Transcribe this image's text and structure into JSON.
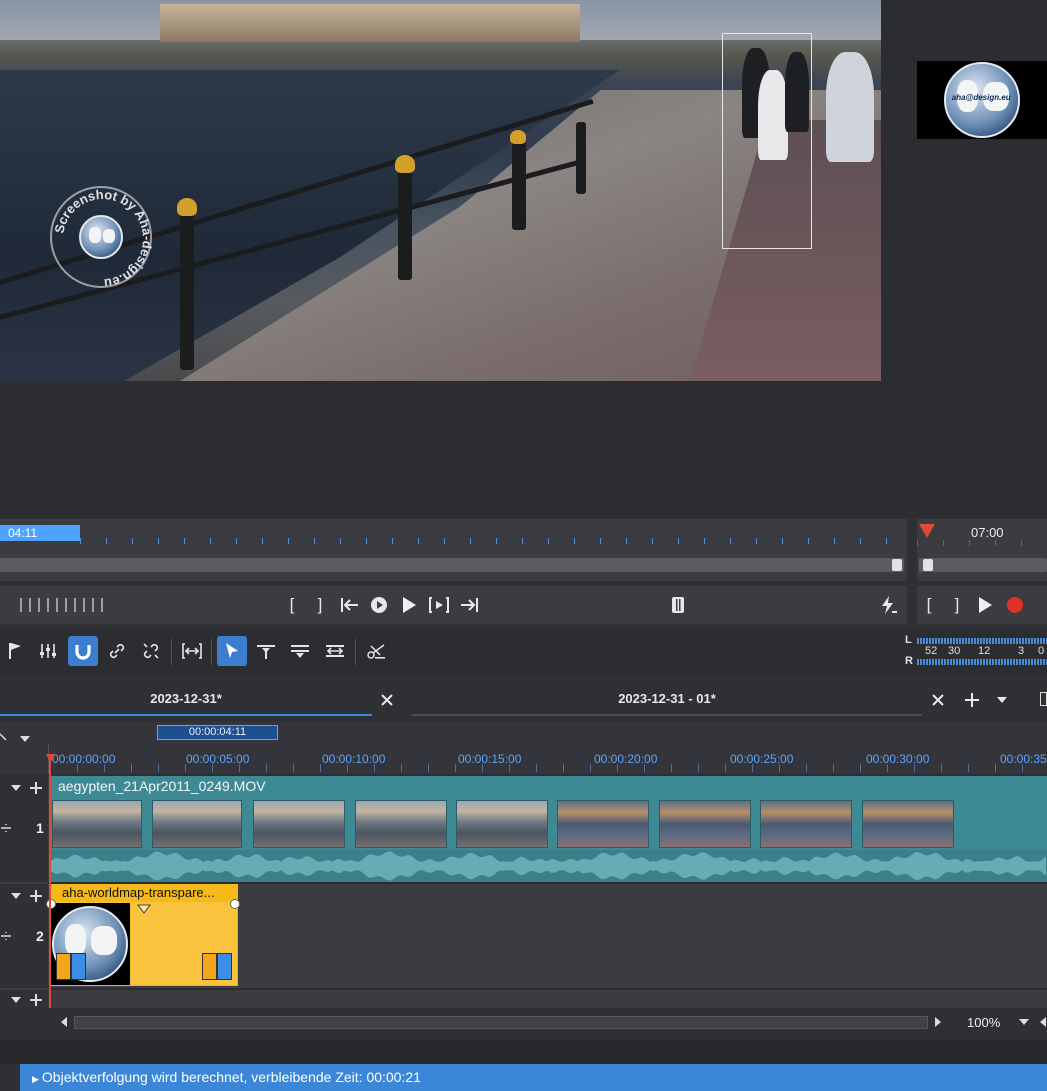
{
  "preview": {
    "watermark_text": "Screenshot by Aha-design.eu",
    "globe_text": "aha@design.eu"
  },
  "scrub": {
    "left_time": "04:11",
    "right_time": "07:00"
  },
  "transport": {
    "mark_in": "[",
    "mark_out": "]",
    "prev_edit": "[←",
    "play": "▶",
    "next_edit": "[▸]",
    "goto_end": "→|",
    "record": "●"
  },
  "audio_meter": {
    "left_label": "L",
    "right_label": "R",
    "scale": [
      "52",
      "30",
      "12",
      "3",
      "0"
    ]
  },
  "tabs": [
    {
      "label": "2023-12-31*",
      "active": true
    },
    {
      "label": "2023-12-31 - 01*",
      "active": false
    }
  ],
  "timeline": {
    "position_chip": "00:00:04:11",
    "ruler_labels": [
      "00:00:00:00",
      "00:00:05:00",
      "00:00:10:00",
      "00:00:15:00",
      "00:00:20:00",
      "00:00:25:00",
      "00:00:30:00",
      "00:00:35"
    ],
    "tracks": [
      {
        "number": "1",
        "clip_name": "aegypten_21Apr2011_0249.MOV"
      },
      {
        "number": "2",
        "clip_name": "aha-worldmap-transpare..."
      }
    ]
  },
  "zoom": "100%",
  "status": "Objektverfolgung wird berechnet, verbleibende Zeit: 00:00:21"
}
